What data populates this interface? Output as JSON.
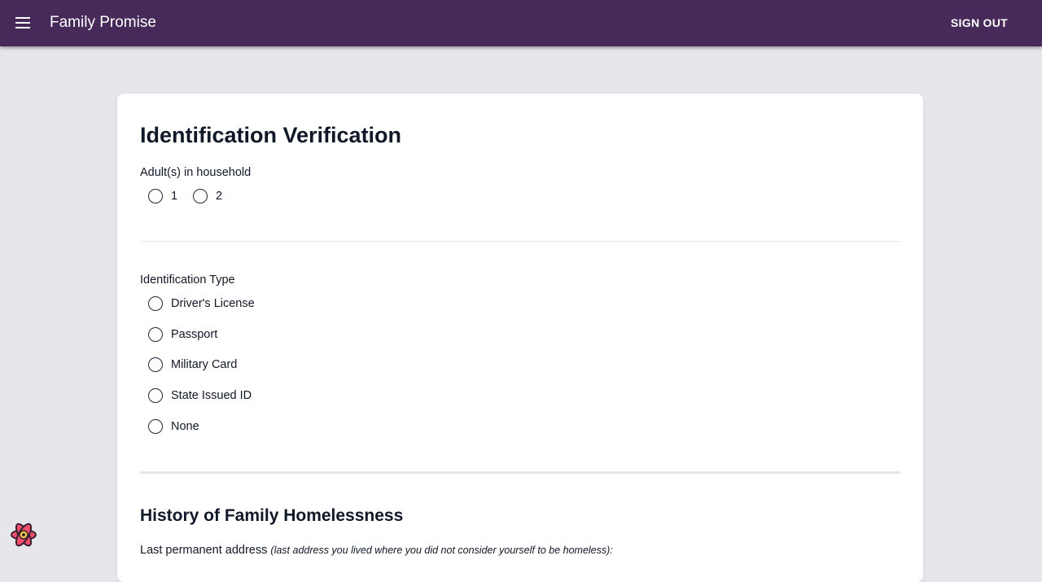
{
  "header": {
    "title": "Family Promise",
    "sign_out_label": "SIGN OUT",
    "menu_icon": "menu-icon"
  },
  "form": {
    "title": "Identification Verification",
    "adults": {
      "label": "Adult(s) in household",
      "options": [
        "1",
        "2"
      ],
      "selected": null
    },
    "id_type": {
      "label": "Identification Type",
      "options": [
        "Driver's License",
        "Passport",
        "Military Card",
        "State Issued ID",
        "None"
      ],
      "selected": null
    },
    "homelessness": {
      "title": "History of Family Homelessness",
      "address_label": "Last permanent address",
      "address_note": "(last address you lived where you did not consider yourself to be homeless):"
    }
  },
  "devtools": {
    "icon": "react-devtools-icon"
  },
  "colors": {
    "appbar": "#472a5a",
    "background": "#e5e7eb",
    "card": "#ffffff"
  }
}
